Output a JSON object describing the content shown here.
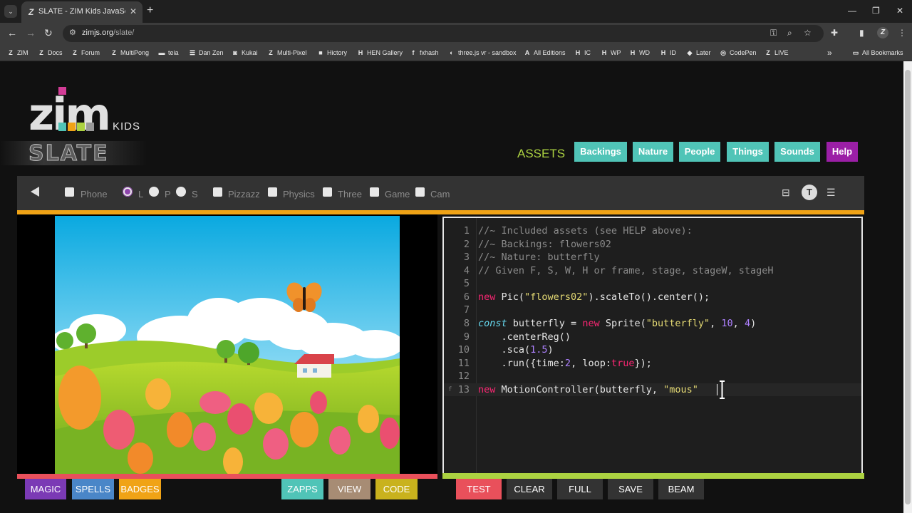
{
  "browser": {
    "tab_title": "SLATE - ZIM Kids JavaScript Ca",
    "tab_favicon": "Z",
    "close": "✕",
    "new_tab": "+",
    "url_host": "zimjs.org",
    "url_path": "/slate/",
    "profile_letter": "Z",
    "bookmarks": [
      {
        "label": "ZIM",
        "icon": "Z"
      },
      {
        "label": "Docs",
        "icon": "Z"
      },
      {
        "label": "Forum",
        "icon": "Z"
      },
      {
        "label": "MultiPong",
        "icon": "Z"
      },
      {
        "label": "teia",
        "icon": "▬"
      },
      {
        "label": "Dan Zen",
        "icon": "☰"
      },
      {
        "label": "Kukai",
        "icon": "◙"
      },
      {
        "label": "Multi-Pixel",
        "icon": "Z"
      },
      {
        "label": "Hictory",
        "icon": "■"
      },
      {
        "label": "HEN Gallery",
        "icon": "H"
      },
      {
        "label": "fxhash",
        "icon": "f"
      },
      {
        "label": "three.js vr - sandbox",
        "icon": "◐"
      },
      {
        "label": "All Editions",
        "icon": "A"
      },
      {
        "label": "IC",
        "icon": "H"
      },
      {
        "label": "WP",
        "icon": "H"
      },
      {
        "label": "WD",
        "icon": "H"
      },
      {
        "label": "ID",
        "icon": "H"
      },
      {
        "label": "Later",
        "icon": "◆"
      },
      {
        "label": "CodePen",
        "icon": "◎"
      },
      {
        "label": "LIVE",
        "icon": "Z"
      }
    ],
    "more_bookmarks": "»",
    "all_bookmarks": "All Bookmarks"
  },
  "logo": {
    "kids": "KIDS",
    "slate": "SLATE"
  },
  "assets": {
    "label": "ASSETS",
    "buttons": [
      {
        "label": "Backings"
      },
      {
        "label": "Nature"
      },
      {
        "label": "People"
      },
      {
        "label": "Things"
      },
      {
        "label": "Sounds"
      },
      {
        "label": "Help"
      }
    ]
  },
  "options": {
    "phone": "Phone",
    "l": "L",
    "p": "P",
    "s": "S",
    "pizzazz": "Pizzazz",
    "physics": "Physics",
    "three": "Three",
    "game": "Game",
    "cam": "Cam",
    "t_icon": "T"
  },
  "code_lines": [
    {
      "n": "1"
    },
    {
      "n": "2"
    },
    {
      "n": "3"
    },
    {
      "n": "4"
    },
    {
      "n": "5"
    },
    {
      "n": "6"
    },
    {
      "n": "7"
    },
    {
      "n": "8"
    },
    {
      "n": "9"
    },
    {
      "n": "10"
    },
    {
      "n": "11"
    },
    {
      "n": "12"
    },
    {
      "n": "13"
    }
  ],
  "code": {
    "l1": "//~ Included assets (see HELP above):",
    "l2": "//~ Backings: flowers02",
    "l3": "//~ Nature: butterfly",
    "l4": "// Given F, S, W, H or frame, stage, stageW, stageH",
    "l6_kw": "new",
    "l6_a": " Pic(",
    "l6_str": "\"flowers02\"",
    "l6_b": ").scaleTo().center();",
    "l8_def": "const",
    "l8_a": " butterfly = ",
    "l8_kw": "new",
    "l8_b": " Sprite(",
    "l8_str": "\"butterfly\"",
    "l8_c": ", ",
    "l8_n1": "10",
    "l8_d": ", ",
    "l8_n2": "4",
    "l8_e": ")",
    "l9": "    .centerReg()",
    "l10_a": "    .sca(",
    "l10_n": "1.5",
    "l10_b": ")",
    "l11_a": "    .run({time:",
    "l11_n": "2",
    "l11_b": ", loop:",
    "l11_kw": "true",
    "l11_c": "});",
    "l13_kw": "new",
    "l13_a": " MotionController(butterfly, ",
    "l13_str": "\"mous\"",
    "fold_marker": "f"
  },
  "bottom_buttons": {
    "magic": "MAGIC",
    "spells": "SPELLS",
    "badges": "BADGES",
    "zapps": "ZAPPS",
    "view": "VIEW",
    "code": "CODE",
    "test": "TEST",
    "clear": "CLEAR",
    "full": "FULL",
    "save": "SAVE",
    "beam": "BEAM"
  },
  "colors": {
    "assets_green": "#acd241",
    "asset_teal": "#50c4b7",
    "help_purple": "#9b1fa6",
    "orange_bar": "#f0a316",
    "red_bar": "#e9505b",
    "green_bar": "#acd241"
  }
}
